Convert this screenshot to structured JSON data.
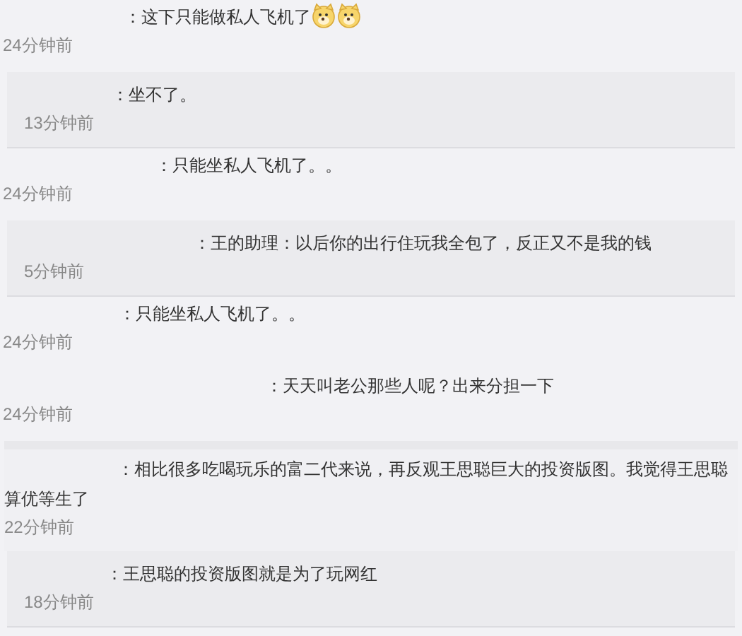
{
  "comments": [
    {
      "kind": "top",
      "text": "：这下只能做私人飞机了",
      "emojis": [
        {
          "kind": "dog"
        },
        {
          "kind": "dog"
        }
      ],
      "time": "24分钟前"
    },
    {
      "kind": "reply",
      "text": "：坐不了。",
      "time": "13分钟前"
    },
    {
      "kind": "top",
      "text": "：只能坐私人飞机了。。",
      "time": "24分钟前"
    },
    {
      "kind": "reply",
      "text": "：王的助理：以后你的出行住玩我全包了，反正又不是我的钱",
      "time": "5分钟前"
    },
    {
      "kind": "top",
      "text": "：只能坐私人飞机了。。",
      "time": "24分钟前"
    },
    {
      "kind": "top",
      "text": "：天天叫老公那些人呢？出来分担一下",
      "time": "24分钟前"
    },
    {
      "kind": "boxed",
      "text": "：相比很多吃喝玩乐的富二代来说，再反观王思聪巨大的投资版图。我觉得王思聪算优等生了",
      "time": "22分钟前"
    },
    {
      "kind": "reply",
      "text": "：王思聪的投资版图就是为了玩网红",
      "time": "18分钟前"
    }
  ]
}
